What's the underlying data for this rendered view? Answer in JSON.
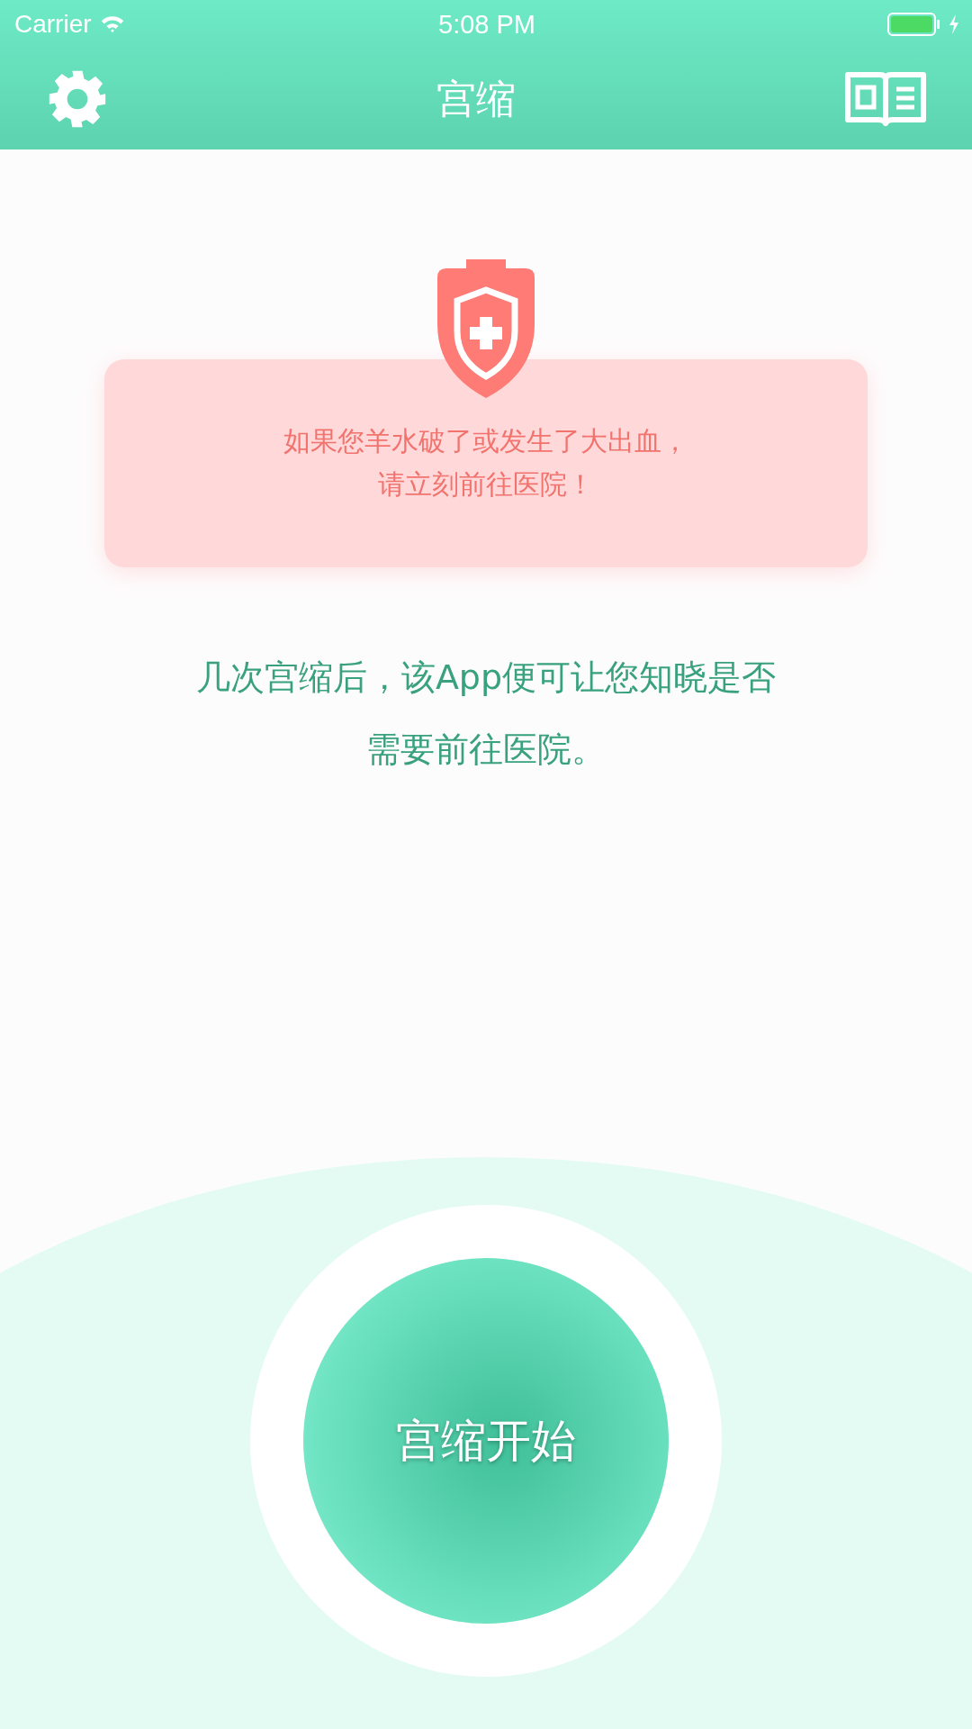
{
  "status_bar": {
    "carrier": "Carrier",
    "time": "5:08 PM"
  },
  "nav": {
    "title": "宫缩"
  },
  "warning": {
    "lines": [
      "如果您羊水破了或发生了大出血，",
      "请立刻前往医院！"
    ]
  },
  "info": {
    "lines": [
      "几次宫缩后，该App便可让您知晓是否",
      "需要前往医院。"
    ]
  },
  "start_button": {
    "label": "宫缩开始"
  }
}
